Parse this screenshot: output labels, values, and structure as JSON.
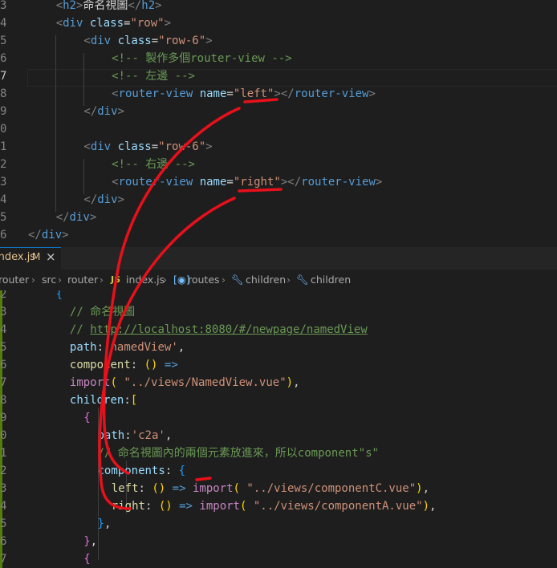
{
  "top_pane": {
    "line_numbers": [
      "3",
      "4",
      "5",
      "6",
      "7",
      "8",
      "9",
      "0",
      "1",
      "2",
      "3",
      "4",
      "5",
      "6"
    ],
    "current_line": "7",
    "lines": [
      {
        "indent": 1,
        "seg": [
          [
            "br",
            "<"
          ],
          [
            "tag",
            "h2"
          ],
          [
            "br",
            ">"
          ],
          [
            "txt",
            "命名視圖"
          ],
          [
            "br",
            "</"
          ],
          [
            "tag",
            "h2"
          ],
          [
            "br",
            ">"
          ]
        ]
      },
      {
        "indent": 1,
        "seg": [
          [
            "br",
            "<"
          ],
          [
            "tag",
            "div"
          ],
          [
            "txt",
            " "
          ],
          [
            "attr",
            "class"
          ],
          [
            "txt",
            "="
          ],
          [
            "str",
            "\"row\""
          ],
          [
            "br",
            ">"
          ]
        ]
      },
      {
        "indent": 2,
        "seg": [
          [
            "br",
            "<"
          ],
          [
            "tag",
            "div"
          ],
          [
            "txt",
            " "
          ],
          [
            "attr",
            "class"
          ],
          [
            "txt",
            "="
          ],
          [
            "str",
            "\"row-6\""
          ],
          [
            "br",
            ">"
          ]
        ]
      },
      {
        "indent": 3,
        "seg": [
          [
            "cm",
            "<!-- 製作多個router-view -->"
          ]
        ]
      },
      {
        "indent": 3,
        "seg": [
          [
            "cm",
            "<!-- 左邊 -->"
          ]
        ]
      },
      {
        "indent": 3,
        "seg": [
          [
            "br",
            "<"
          ],
          [
            "tag",
            "router-view"
          ],
          [
            "txt",
            " "
          ],
          [
            "attr",
            "name"
          ],
          [
            "txt",
            "="
          ],
          [
            "str",
            "\"left\""
          ],
          [
            "br",
            "></"
          ],
          [
            "tag",
            "router-view"
          ],
          [
            "br",
            ">"
          ]
        ]
      },
      {
        "indent": 2,
        "seg": [
          [
            "br",
            "</"
          ],
          [
            "tag",
            "div"
          ],
          [
            "br",
            ">"
          ]
        ]
      },
      {
        "indent": 0,
        "seg": []
      },
      {
        "indent": 2,
        "seg": [
          [
            "br",
            "<"
          ],
          [
            "tag",
            "div"
          ],
          [
            "txt",
            " "
          ],
          [
            "attr",
            "class"
          ],
          [
            "txt",
            "="
          ],
          [
            "str",
            "\"row-6\""
          ],
          [
            "br",
            ">"
          ]
        ]
      },
      {
        "indent": 3,
        "seg": [
          [
            "cm",
            "<!-- 右邊 -->"
          ]
        ]
      },
      {
        "indent": 3,
        "seg": [
          [
            "br",
            "<"
          ],
          [
            "tag",
            "router-view"
          ],
          [
            "txt",
            " "
          ],
          [
            "attr",
            "name"
          ],
          [
            "txt",
            "="
          ],
          [
            "str",
            "\"right\""
          ],
          [
            "br",
            "></"
          ],
          [
            "tag",
            "router-view"
          ],
          [
            "br",
            ">"
          ]
        ]
      },
      {
        "indent": 2,
        "seg": [
          [
            "br",
            "</"
          ],
          [
            "tag",
            "div"
          ],
          [
            "br",
            ">"
          ]
        ]
      },
      {
        "indent": 1,
        "seg": [
          [
            "br",
            "</"
          ],
          [
            "tag",
            "div"
          ],
          [
            "br",
            ">"
          ]
        ]
      },
      {
        "indent": 0,
        "seg": [
          [
            "br",
            "</"
          ],
          [
            "tag",
            "div"
          ],
          [
            "br",
            ">"
          ]
        ]
      }
    ]
  },
  "tab": {
    "label": "index.js",
    "modified": "M",
    "close": "×"
  },
  "breadcrumb": {
    "items": [
      "router",
      "src",
      "router",
      "index.js",
      "routes",
      "children",
      "children"
    ],
    "separator": "›"
  },
  "bottom_pane": {
    "line_numbers": [
      "2",
      "3",
      "4",
      "5",
      "6",
      "7",
      "8",
      "9",
      "0",
      "1",
      "2",
      "3",
      "4",
      "5",
      "6",
      "7"
    ],
    "lines": [
      {
        "indent": 2,
        "seg": [
          [
            "b3",
            "{"
          ]
        ]
      },
      {
        "indent": 3,
        "seg": [
          [
            "cm",
            "// 命名視圖"
          ]
        ]
      },
      {
        "indent": 3,
        "seg": [
          [
            "cm",
            "// "
          ],
          [
            "cmlink",
            "http://localhost:8080/#/newpage/namedView"
          ]
        ]
      },
      {
        "indent": 3,
        "seg": [
          [
            "var",
            "path"
          ],
          [
            "txt",
            ":"
          ],
          [
            "str",
            "'namedView'"
          ],
          [
            "txt",
            ","
          ]
        ]
      },
      {
        "indent": 3,
        "seg": [
          [
            "fn",
            "component"
          ],
          [
            "txt",
            ": "
          ],
          [
            "b1",
            "()"
          ],
          [
            "txt",
            " "
          ],
          [
            "tag",
            "=>"
          ]
        ]
      },
      {
        "indent": 3,
        "seg": [
          [
            "kw",
            "import"
          ],
          [
            "b1",
            "("
          ],
          [
            "txt",
            " "
          ],
          [
            "str",
            "\"../views/NamedView.vue\""
          ],
          [
            "b1",
            ")"
          ],
          [
            "txt",
            ","
          ]
        ]
      },
      {
        "indent": 3,
        "seg": [
          [
            "var",
            "children"
          ],
          [
            "txt",
            ":"
          ],
          [
            "b1",
            "["
          ]
        ]
      },
      {
        "indent": 4,
        "seg": [
          [
            "b2",
            "{"
          ]
        ]
      },
      {
        "indent": 5,
        "seg": [
          [
            "var",
            "path"
          ],
          [
            "txt",
            ":"
          ],
          [
            "str",
            "'c2a'"
          ],
          [
            "txt",
            ","
          ]
        ]
      },
      {
        "indent": 5,
        "seg": [
          [
            "cm",
            "// 命名視圖內的兩個元素放進來，所以component\"s\""
          ]
        ]
      },
      {
        "indent": 5,
        "seg": [
          [
            "var",
            "components"
          ],
          [
            "txt",
            ": "
          ],
          [
            "b3",
            "{"
          ]
        ]
      },
      {
        "indent": 6,
        "seg": [
          [
            "fn",
            "left"
          ],
          [
            "txt",
            ": "
          ],
          [
            "b1",
            "()"
          ],
          [
            "txt",
            " "
          ],
          [
            "tag",
            "=>"
          ],
          [
            "txt",
            " "
          ],
          [
            "kw",
            "import"
          ],
          [
            "b1",
            "("
          ],
          [
            "txt",
            " "
          ],
          [
            "str",
            "\"../views/componentC.vue\""
          ],
          [
            "b1",
            ")"
          ],
          [
            "txt",
            ","
          ]
        ]
      },
      {
        "indent": 6,
        "seg": [
          [
            "fn",
            "right"
          ],
          [
            "txt",
            ": "
          ],
          [
            "b1",
            "()"
          ],
          [
            "txt",
            " "
          ],
          [
            "tag",
            "=>"
          ],
          [
            "txt",
            " "
          ],
          [
            "kw",
            "import"
          ],
          [
            "b1",
            "("
          ],
          [
            "txt",
            " "
          ],
          [
            "str",
            "\"../views/componentA.vue\""
          ],
          [
            "b1",
            ")"
          ],
          [
            "txt",
            ","
          ]
        ]
      },
      {
        "indent": 5,
        "seg": [
          [
            "b3",
            "}"
          ],
          [
            "txt",
            ","
          ]
        ]
      },
      {
        "indent": 4,
        "seg": [
          [
            "b2",
            "}"
          ],
          [
            "txt",
            ","
          ]
        ]
      },
      {
        "indent": 4,
        "seg": [
          [
            "b2",
            "{"
          ]
        ]
      }
    ]
  },
  "annotation_color": "#e8101a"
}
